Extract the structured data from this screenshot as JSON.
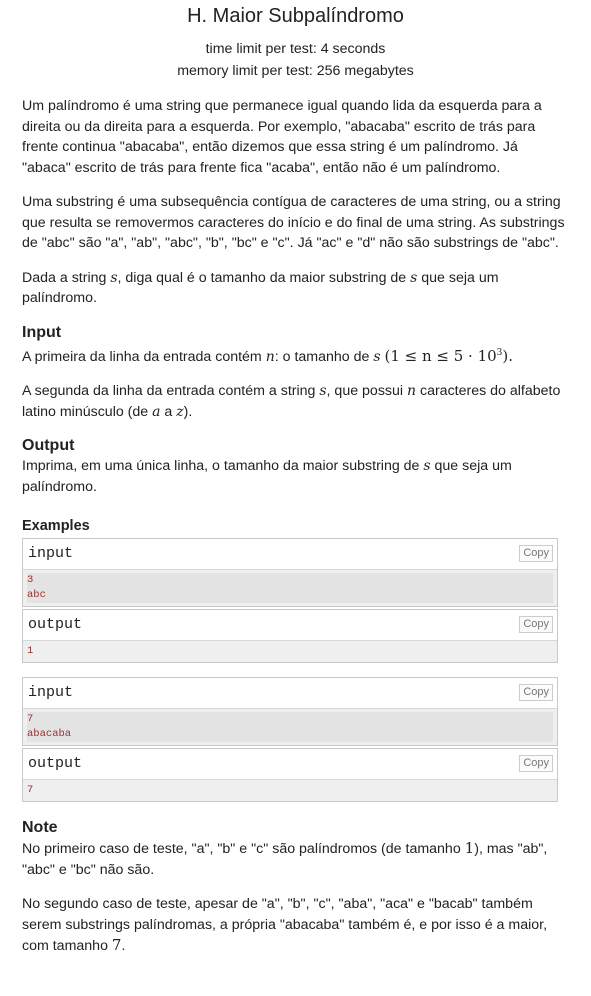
{
  "problem": {
    "title": "H. Maior Subpalíndromo",
    "time_limit": "time limit per test: 4 seconds",
    "memory_limit": "memory limit per test: 256 megabytes"
  },
  "statement": {
    "p1": "Um palíndromo é uma string que permanece igual quando lida da esquerda para a direita ou da direita para a esquerda. Por exemplo, \"abacaba\" escrito de trás para frente continua \"abacaba\", então dizemos que essa string é um palíndromo. Já \"abaca\" escrito de trás para frente fica \"acaba\", então não é um palíndromo.",
    "p2": "Uma substring é uma subsequência contígua de caracteres de uma string, ou a string que resulta se removermos caracteres do início e do final de uma string. As substrings de \"abc\" são \"a\", \"ab\", \"abc\", \"b\", \"bc\" e \"c\". Já \"ac\" e \"d\" não são substrings de \"abc\".",
    "p3_a": "Dada a string ",
    "p3_s1": "s",
    "p3_b": ", diga qual é o tamanho da maior substring de ",
    "p3_s2": "s",
    "p3_c": " que seja um palíndromo."
  },
  "input": {
    "title": "Input",
    "l1_a": "A primeira da linha da entrada contém ",
    "l1_n": "n",
    "l1_b": ": o tamanho de ",
    "l1_s": "s",
    "l1_math": "(1 ≤ n ≤ 5 · 10",
    "l1_exp": "3",
    "l1_end": ").",
    "l2_a": "A segunda da linha da entrada contém a string ",
    "l2_s": "s",
    "l2_b": ", que possui ",
    "l2_n": "n",
    "l2_c": " caracteres do alfabeto latino minúsculo (de ",
    "l2_a_letter": "a",
    "l2_d": " a ",
    "l2_z": "z",
    "l2_e": ")."
  },
  "output": {
    "title": "Output",
    "text_a": "Imprima, em uma única linha, o tamanho da maior substring de ",
    "text_s": "s",
    "text_b": " que seja um palíndromo."
  },
  "examples": {
    "title": "Examples",
    "input_label": "input",
    "output_label": "output",
    "copy_label": "Copy",
    "list": [
      {
        "input_lines": [
          "3",
          "abc"
        ],
        "output_lines": [
          "1"
        ]
      },
      {
        "input_lines": [
          "7",
          "abacaba"
        ],
        "output_lines": [
          "7"
        ]
      }
    ]
  },
  "note": {
    "title": "Note",
    "p1_a": "No primeiro caso de teste, \"a\", \"b\" e \"c\" são palíndromos (de tamanho ",
    "p1_num": "1",
    "p1_b": "), mas \"ab\", \"abc\" e \"bc\" não são.",
    "p2_a": "No segundo caso de teste, apesar de \"a\", \"b\", \"c\", \"aba\", \"aca\" e \"bacab\" também serem substrings palíndromas, a própria \"abacaba\" também é, e por isso é a maior, com tamanho ",
    "p2_num": "7",
    "p2_b": "."
  }
}
